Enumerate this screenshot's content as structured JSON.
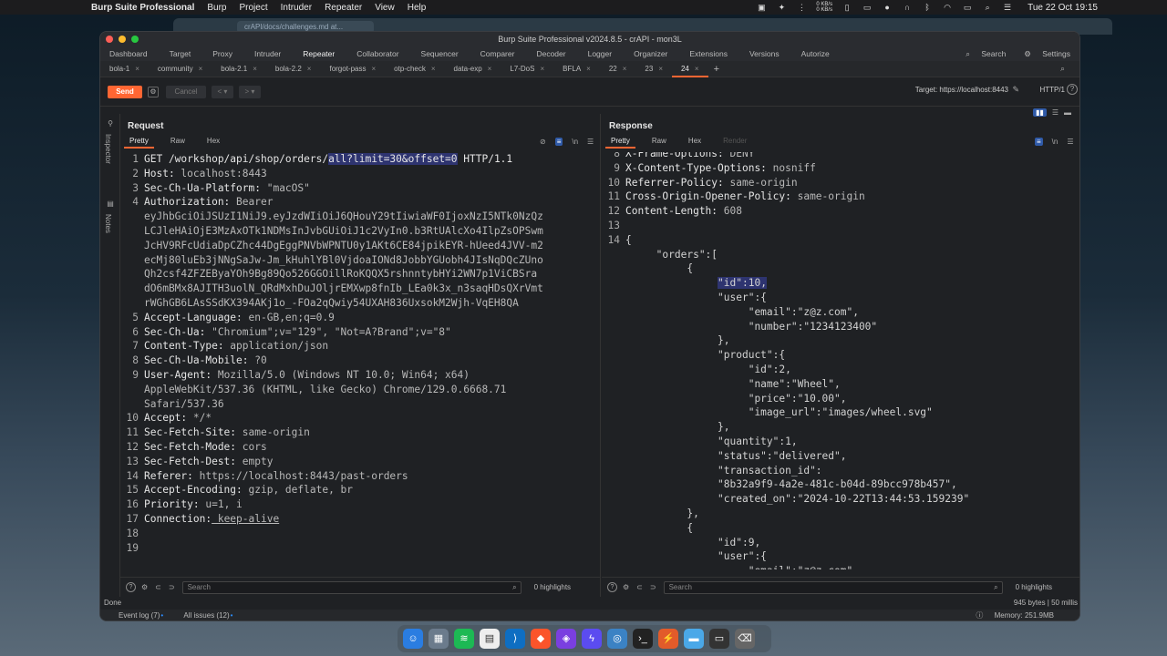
{
  "menubar": {
    "app_name": "Burp Suite Professional",
    "items": [
      "Burp",
      "Project",
      "Intruder",
      "Repeater",
      "View",
      "Help"
    ],
    "net_up": "0 KB/s",
    "net_down": "0 KB/s",
    "clock": "Tue 22 Oct  19:15"
  },
  "browser": {
    "tab_title": "crAPI/docs/challenges.md at..."
  },
  "window": {
    "title": "Burp Suite Professional v2024.8.5 - crAPI - mon3L"
  },
  "tools": {
    "items": [
      "Dashboard",
      "Target",
      "Proxy",
      "Intruder",
      "Repeater",
      "Collaborator",
      "Sequencer",
      "Comparer",
      "Decoder",
      "Logger",
      "Organizer",
      "Extensions",
      "Versions",
      "Autorize"
    ],
    "active": "Repeater",
    "search_label": "Search",
    "settings_label": "Settings"
  },
  "repeater_tabs": [
    "bola-1",
    "community",
    "bola-2.1",
    "bola-2.2",
    "forgot-pass",
    "otp-check",
    "data-exp",
    "L7-DoS",
    "BFLA",
    "22",
    "23",
    "24"
  ],
  "active_tab": "24",
  "actionbar": {
    "send": "Send",
    "cancel": "Cancel",
    "back": "<",
    "forward": ">",
    "target": "Target: https://localhost:8443",
    "protocol": "HTTP/1"
  },
  "side": {
    "inspector": "Inspector",
    "notes": "Notes"
  },
  "request": {
    "title": "Request",
    "subtabs": [
      "Pretty",
      "Raw",
      "Hex"
    ],
    "line1_pre": "GET /workshop/api/shop/orders/",
    "line1_sel": "all?limit=30&offset=0",
    "line1_post": " HTTP/1.1",
    "headers": [
      {
        "n": "2",
        "k": "Host:",
        "v": " localhost:8443"
      },
      {
        "n": "3",
        "k": "Sec-Ch-Ua-Platform:",
        "v": " \"macOS\""
      },
      {
        "n": "4",
        "k": "Authorization:",
        "v": " Bearer"
      }
    ],
    "token_lines": [
      "eyJhbGciOiJSUzI1NiJ9.eyJzdWIiOiJ6QHouY29tIiwiaWF0IjoxNzI5NTk0NzQz",
      "LCJleHAiOjE3MzAxOTk1NDMsInJvbGUiOiJ1c2VyIn0.b3RtUAlcXo4IlpZsOPSwm",
      "JcHV9RFcUdiaDpCZhc44DgEggPNVbWPNTU0y1AKt6CE84jpikEYR-hUeed4JVV-m2",
      "ecMj80luEb3jNNgSaJw-Jm_kHuhlYBl0VjdoaIONd8JobbYGUobh4JIsNqDQcZUno",
      "Qh2csf4ZFZEByaYOh9Bg89Qo526GGOillRoKQQX5rshnntybHYi2WN7p1ViCBSra",
      "dO6mBMx8AJITH3uolN_QRdMxhDuJOljrEMXwp8fnIb_LEa0k3x_n3saqHDsQXrVmt",
      "rWGhGB6LAsSSdKX394AKj1o_-FOa2qQwiy54UXAH836UxsokM2Wjh-VqEH8QA"
    ],
    "headers2": [
      {
        "n": "5",
        "k": "Accept-Language:",
        "v": " en-GB,en;q=0.9"
      },
      {
        "n": "6",
        "k": "Sec-Ch-Ua:",
        "v": " \"Chromium\";v=\"129\", \"Not=A?Brand\";v=\"8\""
      },
      {
        "n": "7",
        "k": "Content-Type:",
        "v": " application/json"
      },
      {
        "n": "8",
        "k": "Sec-Ch-Ua-Mobile:",
        "v": " ?0"
      },
      {
        "n": "9",
        "k": "User-Agent:",
        "v": " Mozilla/5.0 (Windows NT 10.0; Win64; x64)"
      }
    ],
    "ua_cont": [
      "AppleWebKit/537.36 (KHTML, like Gecko) Chrome/129.0.6668.71",
      "Safari/537.36"
    ],
    "headers3": [
      {
        "n": "10",
        "k": "Accept:",
        "v": " */*"
      },
      {
        "n": "11",
        "k": "Sec-Fetch-Site:",
        "v": " same-origin"
      },
      {
        "n": "12",
        "k": "Sec-Fetch-Mode:",
        "v": " cors"
      },
      {
        "n": "13",
        "k": "Sec-Fetch-Dest:",
        "v": " empty"
      },
      {
        "n": "14",
        "k": "Referer:",
        "v": " https://localhost:8443/past-orders"
      },
      {
        "n": "15",
        "k": "Accept-Encoding:",
        "v": " gzip, deflate, br"
      },
      {
        "n": "16",
        "k": "Priority:",
        "v": " u=1, i"
      },
      {
        "n": "17",
        "k": "Connection:",
        "v": " keep-alive"
      }
    ],
    "empty_lines": [
      "18",
      "19"
    ],
    "search_placeholder": "Search",
    "highlights": "0 highlights"
  },
  "response": {
    "title": "Response",
    "subtabs": [
      "Pretty",
      "Raw",
      "Hex",
      "Render"
    ],
    "headers": [
      {
        "n": "8",
        "k": "X-Frame-Options:",
        "v": " DENY"
      },
      {
        "n": "9",
        "k": "X-Content-Type-Options:",
        "v": " nosniff"
      },
      {
        "n": "10",
        "k": "Referrer-Policy:",
        "v": " same-origin"
      },
      {
        "n": "11",
        "k": "Cross-Origin-Opener-Policy:",
        "v": " same-origin"
      },
      {
        "n": "12",
        "k": "Content-Length:",
        "v": " 608"
      }
    ],
    "body_lines": [
      {
        "n": "13",
        "t": ""
      },
      {
        "n": "14",
        "t": "{"
      },
      {
        "n": "",
        "t": "     \"orders\":["
      },
      {
        "n": "",
        "t": "          {"
      },
      {
        "n": "",
        "t": "               \"id\":10,",
        "sel": true
      },
      {
        "n": "",
        "t": "               \"user\":{"
      },
      {
        "n": "",
        "t": "                    \"email\":\"z@z.com\","
      },
      {
        "n": "",
        "t": "                    \"number\":\"1234123400\""
      },
      {
        "n": "",
        "t": "               },"
      },
      {
        "n": "",
        "t": "               \"product\":{"
      },
      {
        "n": "",
        "t": "                    \"id\":2,"
      },
      {
        "n": "",
        "t": "                    \"name\":\"Wheel\","
      },
      {
        "n": "",
        "t": "                    \"price\":\"10.00\","
      },
      {
        "n": "",
        "t": "                    \"image_url\":\"images/wheel.svg\""
      },
      {
        "n": "",
        "t": "               },"
      },
      {
        "n": "",
        "t": "               \"quantity\":1,"
      },
      {
        "n": "",
        "t": "               \"status\":\"delivered\","
      },
      {
        "n": "",
        "t": "               \"transaction_id\":"
      },
      {
        "n": "",
        "t": "               \"8b32a9f9-4a2e-481c-b04d-89bcc978b457\","
      },
      {
        "n": "",
        "t": "               \"created_on\":\"2024-10-22T13:44:53.159239\""
      },
      {
        "n": "",
        "t": "          },"
      },
      {
        "n": "",
        "t": "          {"
      },
      {
        "n": "",
        "t": "               \"id\":9,"
      },
      {
        "n": "",
        "t": "               \"user\":{"
      },
      {
        "n": "",
        "t": "                    \"email\":\"z@z.com\""
      }
    ],
    "search_placeholder": "Search",
    "highlights": "0 highlights"
  },
  "status": {
    "left": "Done",
    "right": "945 bytes | 50 millis"
  },
  "bottom": {
    "event_log": "Event log (7)",
    "issues": "All issues (12)",
    "memory": "Memory: 251.9MB"
  },
  "colors": {
    "accent": "#ff6633",
    "selection": "#2e3470"
  }
}
